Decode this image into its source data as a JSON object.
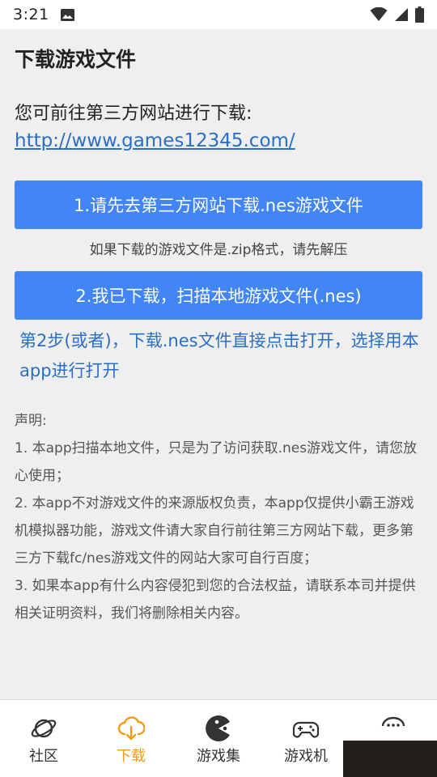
{
  "status_bar": {
    "time": "3:21"
  },
  "header": {
    "title": "下载游戏文件"
  },
  "intro": {
    "text": "您可前往第三方网站进行下载:",
    "link": "http://www.games12345.com/"
  },
  "buttons": {
    "step1": "1.请先去第三方网站下载.nes游戏文件",
    "step1_note": "如果下载的游戏文件是.zip格式，请先解压",
    "step2": "2.我已下载，扫描本地游戏文件(.nes)"
  },
  "step2_alt": "第2步(或者)，下载.nes文件直接点击打开，选择用本app进行打开",
  "statement": {
    "heading": "声明:",
    "items": [
      "1. 本app扫描本地文件，只是为了访问获取.nes游戏文件，请您放心使用；",
      "2. 本app不对游戏文件的来源版权负责，本app仅提供小霸王游戏机模拟器功能，游戏文件请大家自行前往第三方网站下载，更多第三方下载fc/nes游戏文件的网站大家可自行百度；",
      "3. 如果本app有什么内容侵犯到您的合法权益，请联系本司并提供相关证明资料，我们将删除相关内容。"
    ]
  },
  "bottom_nav": [
    {
      "label": "社区",
      "icon": "planet-icon",
      "active": false
    },
    {
      "label": "下载",
      "icon": "cloud-download-icon",
      "active": true
    },
    {
      "label": "游戏集",
      "icon": "pacman-icon",
      "active": false
    },
    {
      "label": "游戏机",
      "icon": "gamepad-icon",
      "active": false
    },
    {
      "label": "",
      "icon": "chat-icon",
      "active": false
    }
  ],
  "colors": {
    "accent": "#4285f4",
    "link": "#2a6fc7",
    "active_tab": "#f39c12"
  }
}
